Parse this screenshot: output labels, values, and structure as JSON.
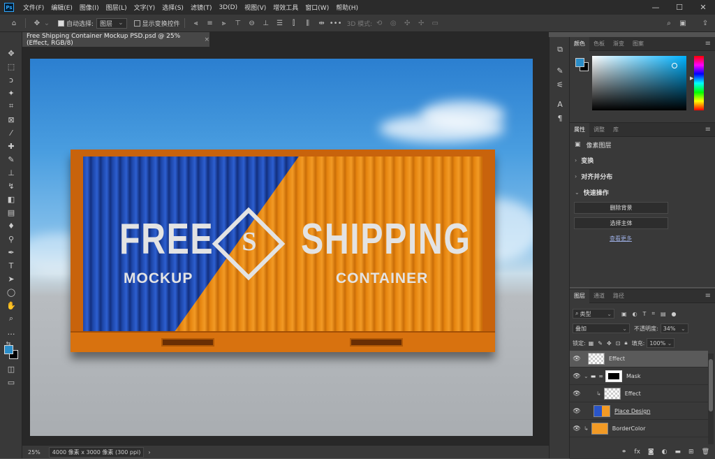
{
  "app": {
    "logo": "Ps"
  },
  "menu": [
    "文件(F)",
    "编辑(E)",
    "图像(I)",
    "图层(L)",
    "文字(Y)",
    "选择(S)",
    "滤镜(T)",
    "3D(D)",
    "视图(V)",
    "增效工具",
    "窗口(W)",
    "帮助(H)"
  ],
  "window_controls": {
    "minimize": "—",
    "maximize": "☐",
    "close": "✕"
  },
  "options": {
    "auto_select_label": "自动选择:",
    "auto_select_value": "图层",
    "show_transform_label": "显示变换控件",
    "more": "•••",
    "mode3d_label": "3D 模式:"
  },
  "document": {
    "tab_title": "Free Shipping Container Mockup PSD.psd @ 25% (Effect, RGB/8)",
    "close": "×"
  },
  "artwork": {
    "word1": "FREE",
    "word2": "SHIPPING",
    "sub1": "MOCKUP",
    "sub2": "CONTAINER",
    "emblem": "S"
  },
  "status": {
    "zoom": "25%",
    "doc_info": "4000 像素 x 3000 像素 (300 ppi)",
    "arrow": "›"
  },
  "color_panel": {
    "tabs": [
      "颜色",
      "色板",
      "渐变",
      "图案"
    ],
    "foreground": "#2a8dc8",
    "background": "#000000"
  },
  "properties_panel": {
    "tabs": [
      "属性",
      "调整",
      "库"
    ],
    "layer_type": "像素图层",
    "sections": [
      "变换",
      "对齐并分布",
      "快速操作"
    ],
    "buttons": [
      "删除背景",
      "选择主体"
    ],
    "more_link": "查看更多"
  },
  "layers_panel": {
    "tabs": [
      "图层",
      "通道",
      "路径"
    ],
    "filter_label": "类型",
    "blend_mode": "叠加",
    "opacity_label": "不透明度:",
    "opacity_value": "34%",
    "lock_label": "锁定:",
    "fill_label": "填充:",
    "fill_value": "100%",
    "layers": [
      {
        "name": "Effect",
        "selected": true
      },
      {
        "name": "Mask",
        "selected": false
      },
      {
        "name": "Effect",
        "selected": false
      },
      {
        "name": "Place Design",
        "selected": false
      },
      {
        "name": "BorderColor",
        "selected": false
      }
    ]
  }
}
